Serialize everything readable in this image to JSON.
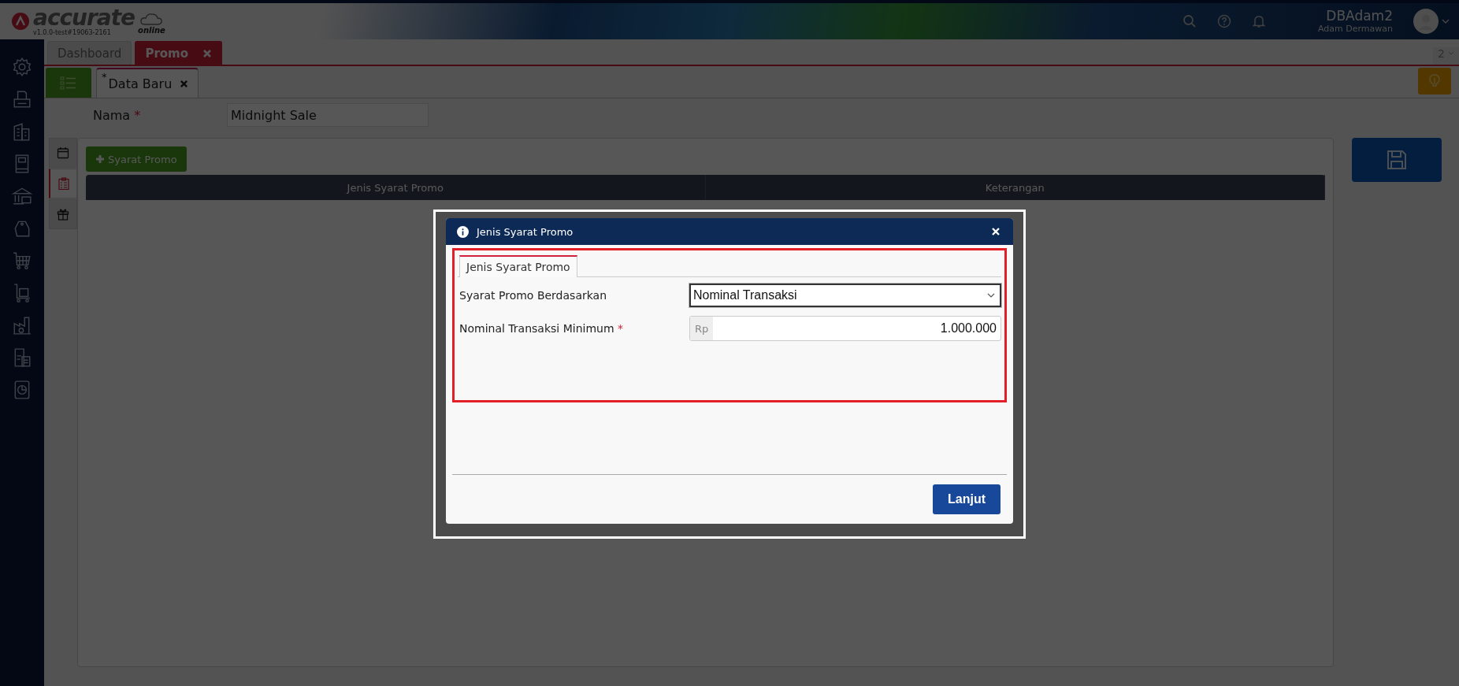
{
  "app": {
    "logo": "accurate",
    "logo_sub": "online",
    "version": "v1.0.0-test#19063-2161"
  },
  "user": {
    "db": "DBAdam2",
    "name": "Adam Dermawan"
  },
  "tabs": [
    {
      "label": "Dashboard",
      "selected": false,
      "closable": false
    },
    {
      "label": "Promo",
      "selected": true,
      "closable": true
    }
  ],
  "tab_count": "2",
  "doc_tabs": [
    {
      "label": "Data Baru",
      "marker": "*",
      "selected": true
    }
  ],
  "required_mark": "*",
  "form": {
    "label": "Nama",
    "required": true,
    "value": "Midnight Sale"
  },
  "side_tabs": [
    {
      "selected": false
    },
    {
      "selected": true
    },
    {
      "selected": false
    }
  ],
  "add_button": "Syarat Promo",
  "table": {
    "columns": [
      "Jenis Syarat Promo",
      "Keterangan"
    ]
  },
  "dialog": {
    "title": "Jenis Syarat Promo",
    "tabs": [
      {
        "label": "Jenis Syarat Promo",
        "selected": true
      }
    ],
    "fields": [
      {
        "kind": "select",
        "label": "Syarat Promo Berdasarkan",
        "required": false,
        "value": "Nominal Transaksi"
      },
      {
        "kind": "currency",
        "label": "Nominal Transaksi Minimum",
        "required": true,
        "prefix": "Rp",
        "value": "1.000.000"
      }
    ],
    "button": "Lanjut"
  }
}
